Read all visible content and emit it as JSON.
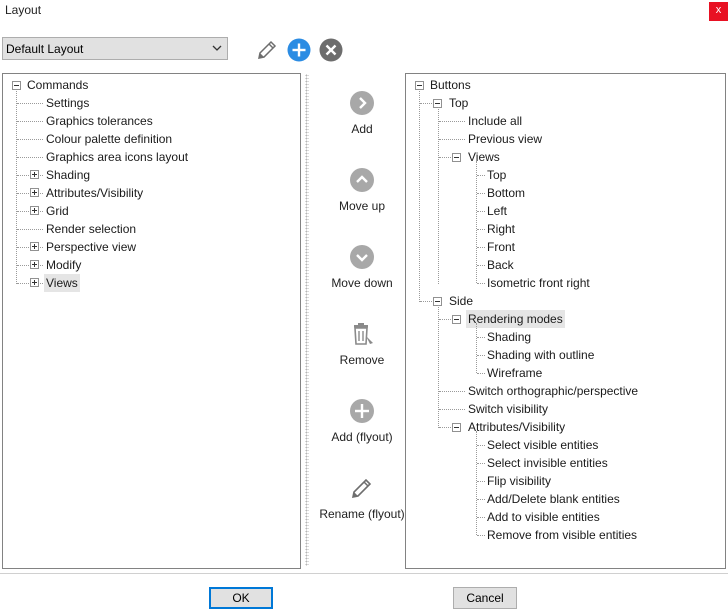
{
  "window": {
    "title": "Layout",
    "close_glyph": "x"
  },
  "toolbar": {
    "layout_select": {
      "value": "Default Layout"
    },
    "icons": [
      "pencil-icon",
      "plus-circle-icon",
      "close-circle-icon"
    ]
  },
  "left_tree": {
    "root": "Commands",
    "children": [
      "Settings",
      "Graphics tolerances",
      "Colour palette definition",
      "Graphics area icons layout",
      "Shading",
      "Attributes/Visibility",
      "Grid",
      "Render selection",
      "Perspective view",
      "Modify",
      "Views"
    ]
  },
  "actions": [
    {
      "label": "Add",
      "icon": "chevron-right-icon"
    },
    {
      "label": "Move up",
      "icon": "chevron-up-icon"
    },
    {
      "label": "Move down",
      "icon": "chevron-down-icon"
    },
    {
      "label": "Remove",
      "icon": "trash-icon"
    },
    {
      "label": "Add (flyout)",
      "icon": "plus-circle-icon"
    },
    {
      "label": "Rename (flyout)",
      "icon": "pencil-icon"
    }
  ],
  "right_tree": {
    "root": "Buttons",
    "top": {
      "label": "Top",
      "include_all": "Include all",
      "previous_view": "Previous view",
      "views": {
        "label": "Views",
        "items": [
          "Top",
          "Bottom",
          "Left",
          "Right",
          "Front",
          "Back",
          "Isometric front right"
        ]
      }
    },
    "side": {
      "label": "Side",
      "rendering_modes": {
        "label": "Rendering modes",
        "items": [
          "Shading",
          "Shading with outline",
          "Wireframe"
        ]
      },
      "switch_ortho": "Switch orthographic/perspective",
      "switch_visibility": "Switch visibility",
      "attributes": {
        "label": "Attributes/Visibility",
        "items": [
          "Select visible entities",
          "Select invisible entities",
          "Flip visibility",
          "Add/Delete blank entities",
          "Add to visible entities",
          "Remove from visible entities"
        ]
      }
    }
  },
  "footer": {
    "ok": "OK",
    "cancel": "Cancel"
  },
  "colors": {
    "accent": "#2b8ce3",
    "gray_icon": "#a8a8a8",
    "close_red": "#e81123"
  }
}
